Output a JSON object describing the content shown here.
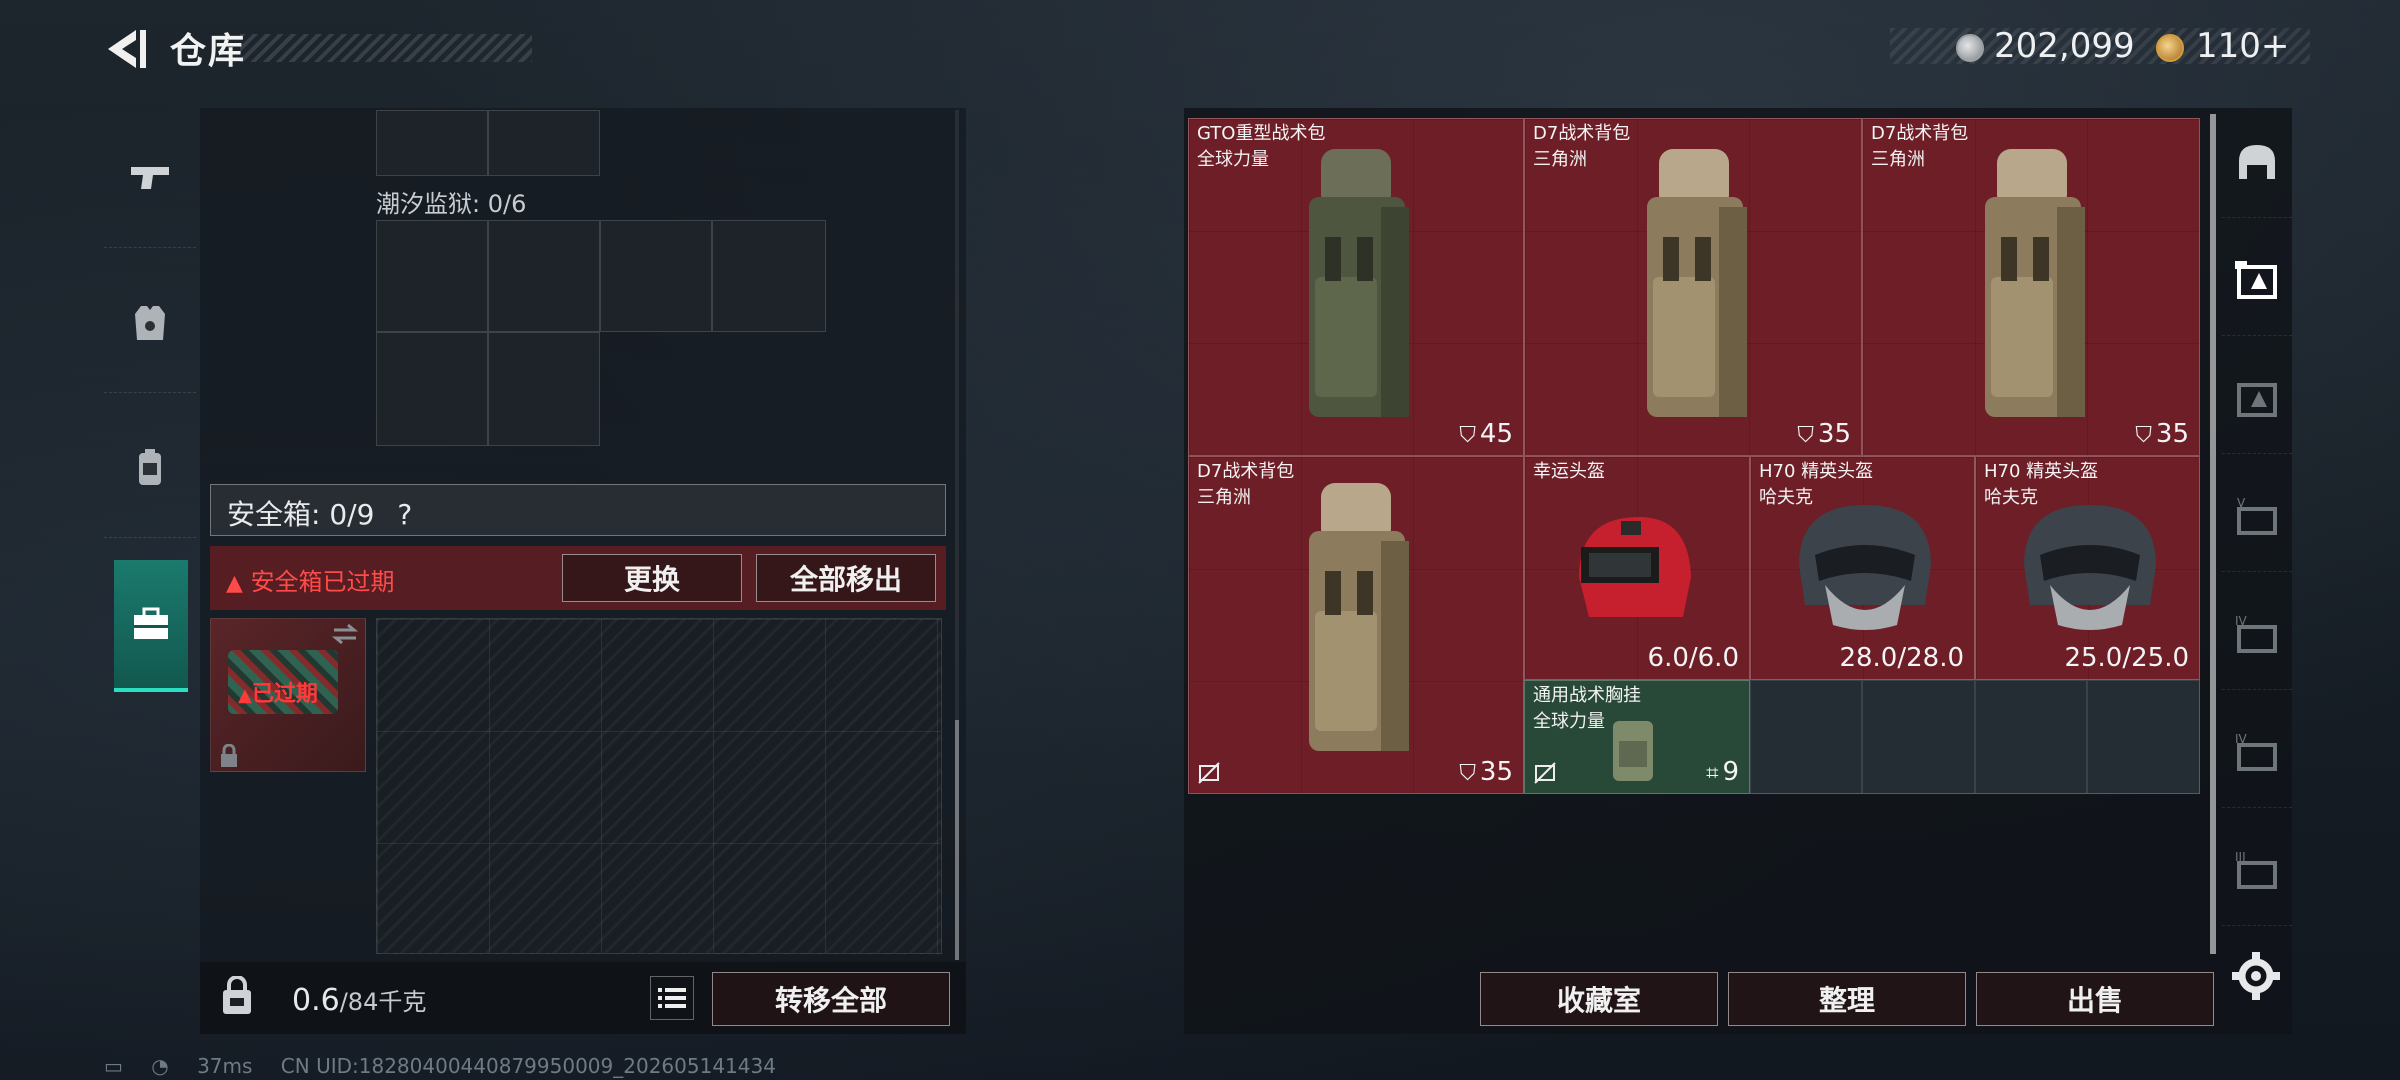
{
  "header": {
    "title": "仓库",
    "currency_1": "202,099",
    "currency_2": "110+"
  },
  "left_panel": {
    "tide_prison_label": "潮汐监狱: 0/6",
    "safe_box_label": "安全箱: 0/9",
    "safe_box_help": "?",
    "expired_warning": "安全箱已过期",
    "replace_button": "更换",
    "move_all_button": "全部移出",
    "expired_tag": "已过期",
    "weight_value": "0.6",
    "weight_capacity": "/84千克",
    "transfer_all_button": "转移全部"
  },
  "stash_items": [
    {
      "name": "GTO重型战术包",
      "sub": "全球力量",
      "value": "45"
    },
    {
      "name": "D7战术背包",
      "sub": "三角洲",
      "value": "35"
    },
    {
      "name": "D7战术背包",
      "sub": "三角洲",
      "value": "35"
    },
    {
      "name": "D7战术背包",
      "sub": "三角洲",
      "value": "35"
    },
    {
      "name": "幸运头盔",
      "sub": "",
      "value": "6.0/6.0"
    },
    {
      "name": "H70 精英头盔",
      "sub": "哈夫克",
      "value": "28.0/28.0"
    },
    {
      "name": "H70 精英头盔",
      "sub": "哈夫克",
      "value": "25.0/25.0"
    },
    {
      "name": "通用战术胸挂",
      "sub": "全球力量",
      "value": "9"
    }
  ],
  "right_panel": {
    "collection_button": "收藏室",
    "tidy_button": "整理",
    "sell_button": "出售"
  },
  "status": {
    "ping": "37ms",
    "uid": "CN UID:18280400440879950009_202605141434"
  },
  "colors": {
    "item_red": "#6e1e27",
    "item_green": "#284838",
    "accent_teal": "#2be0c0",
    "warning_red": "#ff4a4a"
  },
  "icons": {
    "left_nav": [
      "pistol-icon",
      "armor-icon",
      "backpack-icon",
      "toolbox-icon"
    ],
    "right_nav": [
      "helmet-slot-icon",
      "tier-icon",
      "tier-icon",
      "tier-v-icon",
      "tier-iv-icon",
      "tier-iv-icon",
      "tier-iii-icon"
    ]
  }
}
